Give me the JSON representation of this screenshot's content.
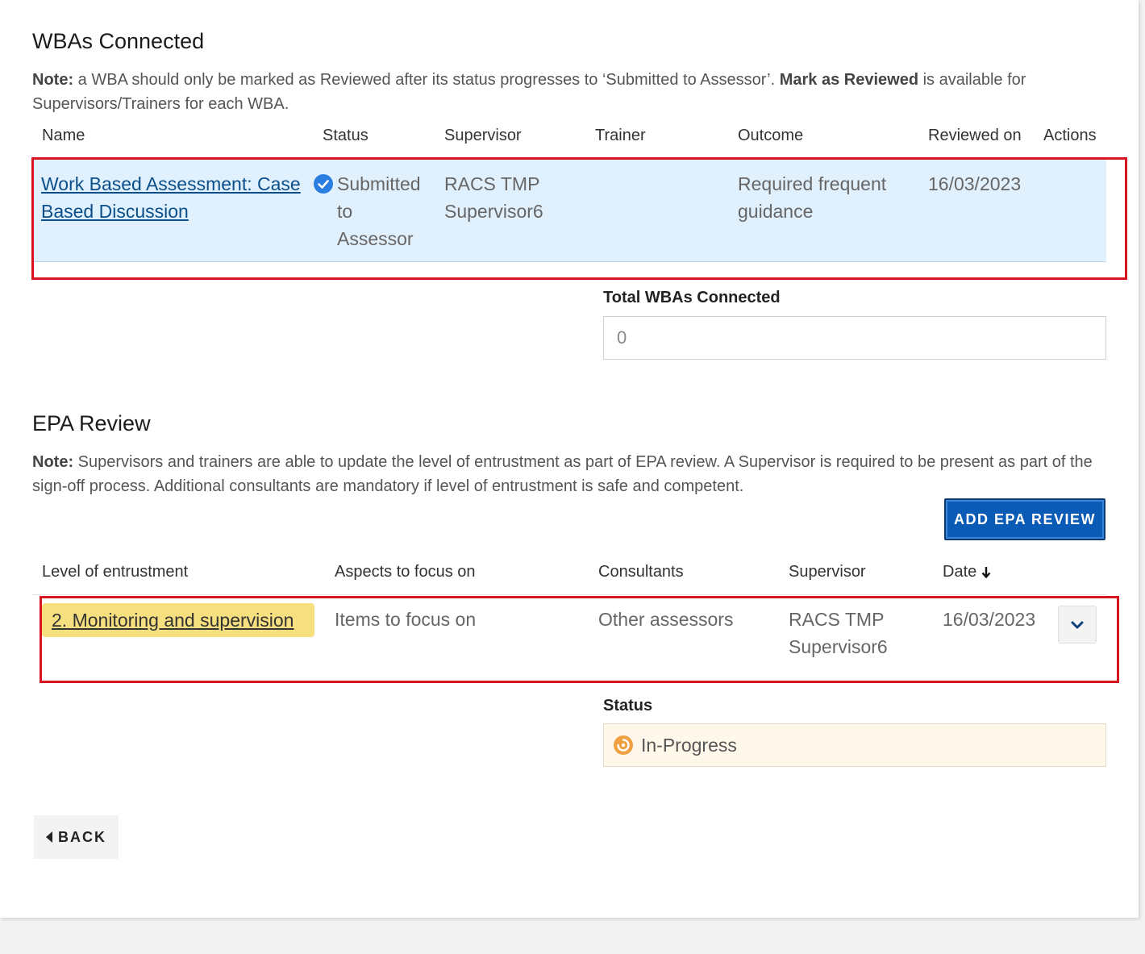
{
  "wba_section": {
    "title": "WBAs Connected",
    "note_label": "Note:",
    "note_text_1": " a WBA should only be marked as Reviewed after its status progresses to ‘Submitted to Assessor’. ",
    "note_bold": "Mark as Reviewed",
    "note_text_2": " is available for Supervisors/Trainers for each WBA.",
    "columns": [
      "Name",
      "Status",
      "Supervisor",
      "Trainer",
      "Outcome",
      "Reviewed on",
      "Actions"
    ],
    "row": {
      "name_line1": "Work Based Assessment: Case",
      "name_line2": "Based Discussion",
      "status_line1": "Submitted",
      "status_line2": "to",
      "status_line3": "Assessor",
      "supervisor_line1": "RACS TMP",
      "supervisor_line2": "Supervisor6",
      "trainer": "",
      "outcome_line1": "Required frequent",
      "outcome_line2": "guidance",
      "reviewed_on": "16/03/2023"
    },
    "total_label": "Total WBAs Connected",
    "total_value": "0"
  },
  "epa_section": {
    "title": "EPA Review",
    "note_label": "Note:",
    "note_text": " Supervisors and trainers are able to update the level of entrustment as part of EPA review. A Supervisor is required to be present as part of the sign-off process. Additional consultants are mandatory if level of entrustment is safe and competent.",
    "add_button": "ADD EPA REVIEW",
    "columns": [
      "Level of entrustment",
      "Aspects to focus on",
      "Consultants",
      "Supervisor",
      "Date"
    ],
    "row": {
      "level": "2. Monitoring and supervision",
      "aspects": "Items to focus on",
      "consultants": "Other assessors",
      "supervisor_line1": "RACS TMP",
      "supervisor_line2": "Supervisor6",
      "date": "16/03/2023"
    },
    "status_label": "Status",
    "status_value": "In-Progress"
  },
  "back_button": "BACK",
  "colors": {
    "accent": "#0a5bb5",
    "row_highlight": "#e1f0fd",
    "chip": "#f6df7f",
    "status_bg": "#fff7ea",
    "highlight_border": "#d7141f"
  }
}
